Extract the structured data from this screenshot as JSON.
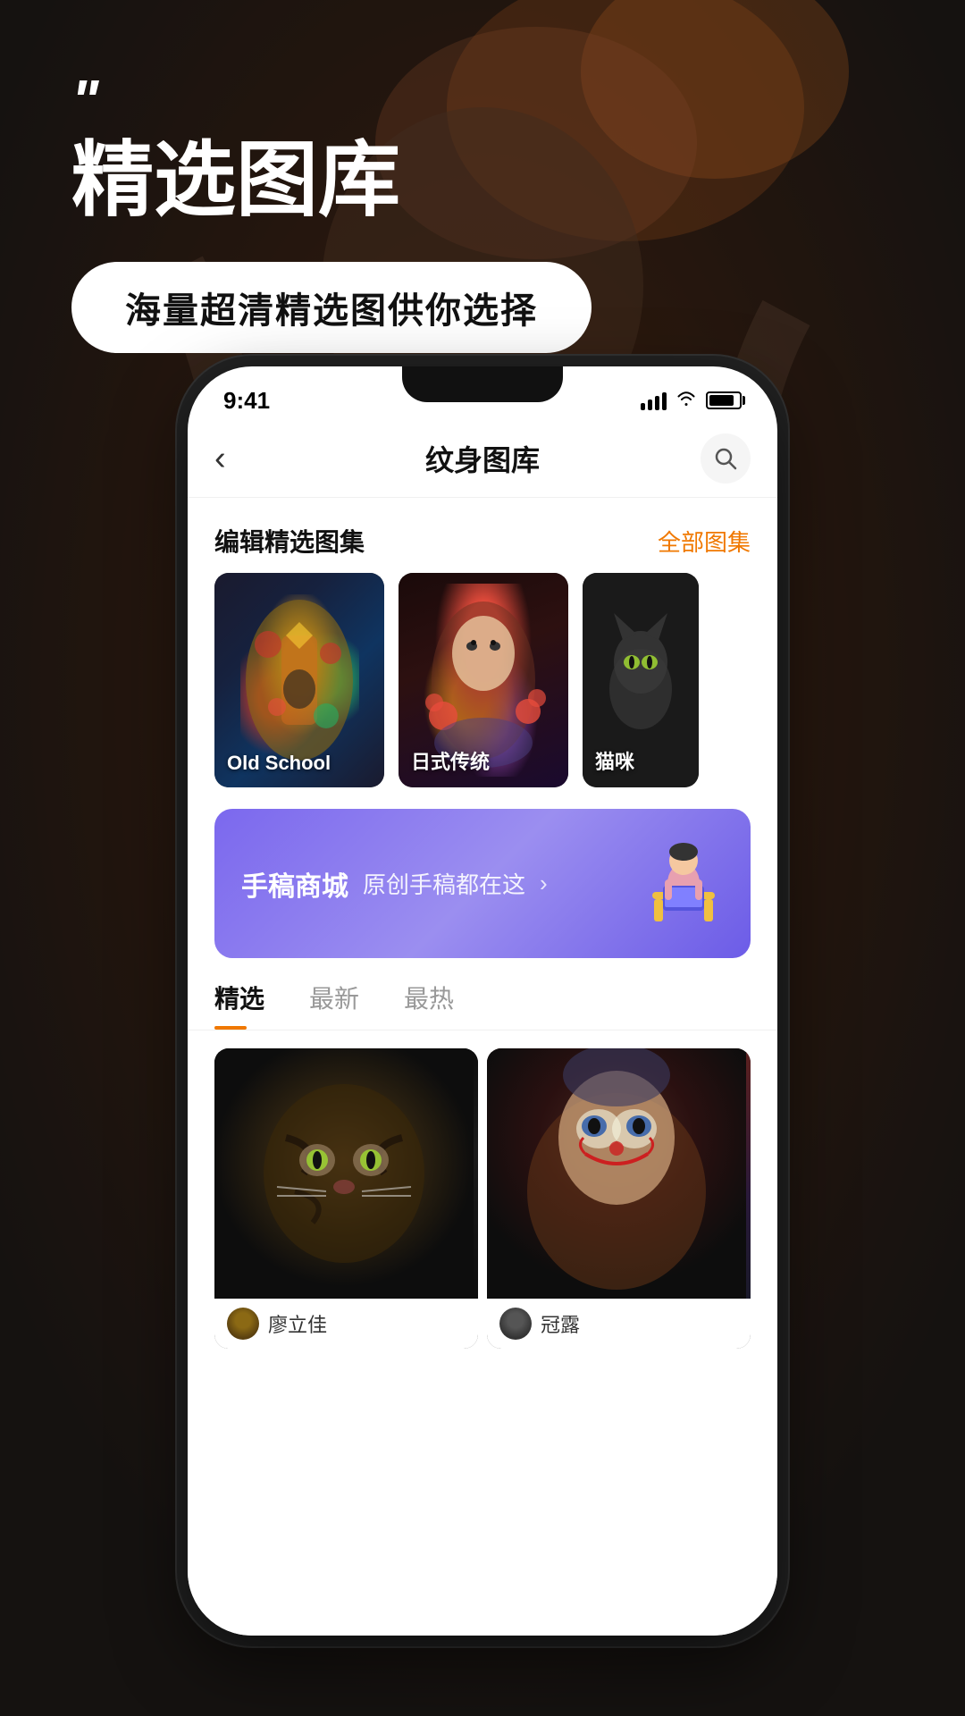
{
  "background": {
    "color": "#1e1208"
  },
  "hero": {
    "quote_marks": "\"",
    "main_title": "精选图库",
    "subtitle": "海量超清精选图供你选择"
  },
  "status_bar": {
    "time": "9:41"
  },
  "nav": {
    "title": "纹身图库",
    "back_icon": "‹",
    "search_icon": "🔍"
  },
  "editor_section": {
    "title": "编辑精选图集",
    "link": "全部图集",
    "items": [
      {
        "label": "Old School",
        "style": "old-school"
      },
      {
        "label": "日式传统",
        "style": "japanese"
      },
      {
        "label": "猫咪",
        "style": "cat"
      }
    ]
  },
  "banner": {
    "title": "手稿商城",
    "subtitle": "原创手稿都在这",
    "arrow": "›",
    "illustration": "🧑‍💻"
  },
  "tabs": [
    {
      "label": "精选",
      "active": true
    },
    {
      "label": "最新",
      "active": false
    },
    {
      "label": "最热",
      "active": false
    }
  ],
  "gallery": {
    "items": [
      {
        "user_name": "廖立佳",
        "style": "tiger"
      },
      {
        "user_name": "冠露",
        "style": "joker"
      }
    ]
  }
}
